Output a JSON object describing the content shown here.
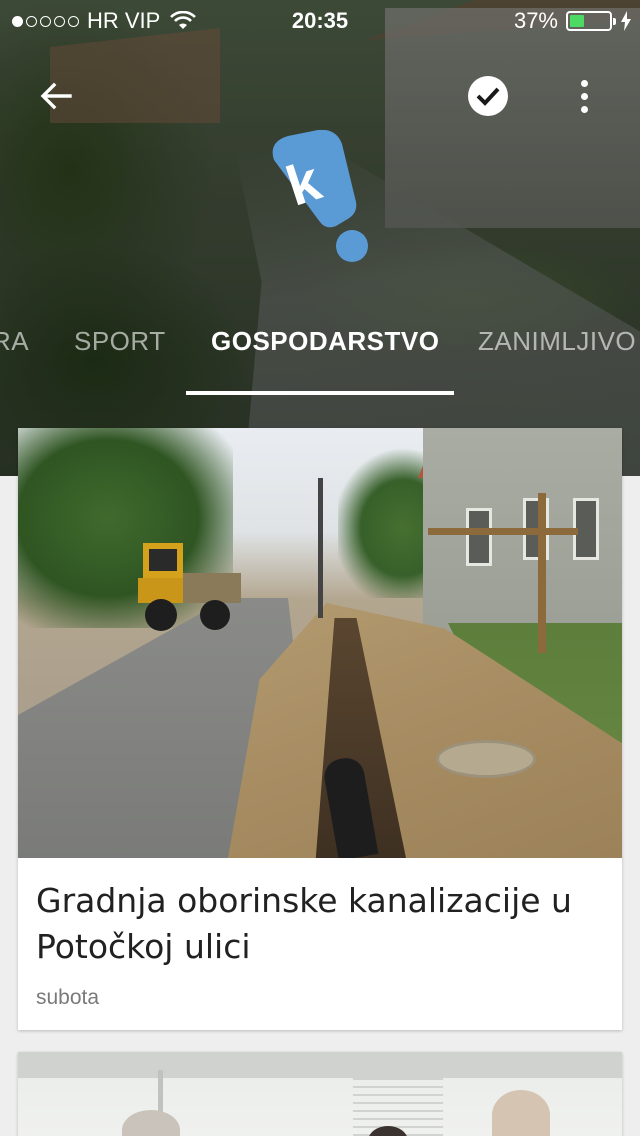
{
  "status_bar": {
    "carrier": "HR VIP",
    "time": "20:35",
    "battery": "37%",
    "battery_level": 0.37,
    "signal_dots_filled": 1,
    "signal_dots_total": 5
  },
  "toolbar": {
    "back_icon": "arrow-back-icon",
    "check_icon": "check-circle-icon",
    "more_icon": "more-vert-icon"
  },
  "logo": {
    "letter": "k",
    "color": "#5b9bd5"
  },
  "tabs": [
    {
      "label": "RA"
    },
    {
      "label": "SPORT"
    },
    {
      "label": "GOSPODARSTVO",
      "active": true
    },
    {
      "label": "ZANIMLJIVO"
    }
  ],
  "articles": [
    {
      "title": "Gradnja oborinske kanalizacije u Potočkoj ulici",
      "date": "subota"
    }
  ],
  "colors": {
    "accent": "#5b9bd5",
    "battery_green": "#4cd964",
    "title_text": "#212121",
    "date_text": "#7a7a7a"
  }
}
